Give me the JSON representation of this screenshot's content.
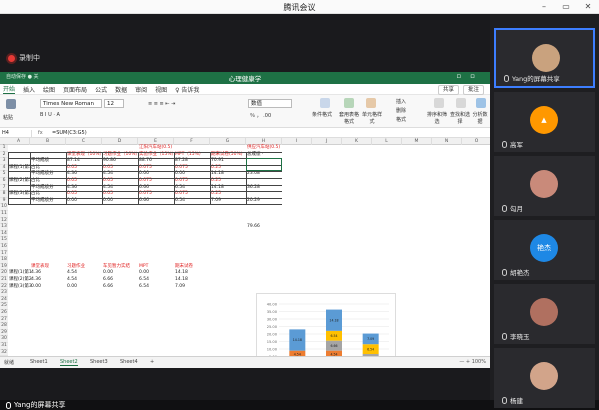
{
  "app": {
    "title": "腾讯会议",
    "window_controls": [
      "–",
      "▭",
      "✕"
    ]
  },
  "recording": {
    "label": "录制中"
  },
  "excel": {
    "autosave": "自动保存",
    "autosave_state": "● 关",
    "title": "心理健康学",
    "menus": [
      "开始",
      "插入",
      "绘图",
      "页面布局",
      "公式",
      "数据",
      "审阅",
      "视图",
      "♀ 告诉我"
    ],
    "share_labels": [
      "共享",
      "批注"
    ],
    "ribbon": {
      "paste": "粘贴",
      "font_name": "Times New Roman",
      "font_size": "12",
      "font_controls": "B  I  U  ·  A",
      "align_controls": "≡ ≡ ≡  ⇤ ⇥",
      "number_format": "数值",
      "number_controls": "％  ，  .00",
      "styles": [
        "条件格式",
        "套用表格格式",
        "单元格样式"
      ],
      "cells": [
        "插入",
        "删除",
        "格式"
      ],
      "edit": [
        "排序和筛选",
        "查找和选择",
        "分析数据"
      ]
    },
    "namebox": "H4",
    "fx": "fx",
    "formula": "=SUM(C3:G5)",
    "columns": [
      "A",
      "B",
      "C",
      "D",
      "E",
      "F",
      "G",
      "H",
      "I",
      "J",
      "K",
      "L",
      "M",
      "N",
      "O"
    ],
    "rows": [
      "1",
      "2",
      "3",
      "4",
      "5",
      "6",
      "7",
      "8",
      "9",
      "10",
      "11",
      "12",
      "13",
      "14",
      "15",
      "16",
      "17",
      "18",
      "19",
      "20",
      "21",
      "22",
      "23",
      "24",
      "25",
      "26",
      "27",
      "28",
      "29",
      "30",
      "31",
      "32"
    ],
    "table1": {
      "hdr_top_c": "江阳汽车站(0.5)",
      "hdr_top_g": "供应汽车站(0.5)",
      "headers": [
        "课堂表现（10%）",
        "习题作业（10%）",
        "实验作业（15%）",
        "MPT（15%）",
        "期末试卷(50%)",
        "总成绩 ·"
      ],
      "rows": [
        [
          "",
          "平均成绩",
          "87.14",
          "90.86",
          "88.76",
          "87.28",
          "70.91",
          ""
        ],
        [
          "课程(1)第1",
          "占比",
          "0.05",
          "0.05",
          "0.075",
          "0.075",
          "0.25",
          ""
        ],
        [
          "",
          "平均成绩分",
          "4.36",
          "4.54",
          "0.00",
          "0.00",
          "14.18",
          "23.08"
        ],
        [
          "课程(2)第1",
          "占比",
          "0.05",
          "0.05",
          "0.075",
          "0.075",
          "0.25",
          ""
        ],
        [
          "",
          "平均成绩分",
          "4.36",
          "4.54",
          "6.66",
          "6.54",
          "14.18",
          "36.28"
        ],
        [
          "课程(3)第1",
          "占比",
          "0.05",
          "0.05",
          "0.075",
          "0.075",
          "0.25",
          ""
        ],
        [
          "",
          "平均成绩分",
          "0.00",
          "0.00",
          "6.66",
          "6.54",
          "7.09",
          "20.29"
        ]
      ],
      "total": "79.66"
    },
    "table2": {
      "headers": [
        "课堂表现",
        "习题作业",
        "车见暂力实结",
        "MPT",
        "期末试卷"
      ],
      "rows": [
        [
          "课程(1)第1",
          "4.36",
          "4.54",
          "0.00",
          "0.00",
          "14.18"
        ],
        [
          "课程(2)第2",
          "4.36",
          "4.54",
          "6.66",
          "6.54",
          "14.18"
        ],
        [
          "课程(3)第3",
          "0.00",
          "0.00",
          "6.66",
          "6.54",
          "7.09"
        ]
      ]
    },
    "sheets": [
      "Sheet1",
      "Sheet2",
      "Sheet3",
      "Sheet4",
      "+"
    ],
    "active_sheet": "Sheet2",
    "status_left": "就绪",
    "status_right": "— + 100%"
  },
  "chart_data": {
    "type": "bar",
    "stacked": true,
    "categories": [
      "课程(1)第1",
      "课程(2)第2",
      "课程(3)第3"
    ],
    "series": [
      {
        "name": "课堂表现",
        "color": "#4472c4",
        "values": [
          4.36,
          4.36,
          0.0
        ]
      },
      {
        "name": "习题作业",
        "color": "#ed7d31",
        "values": [
          4.54,
          4.54,
          0.0
        ]
      },
      {
        "name": "车见暂力实结",
        "color": "#a5a5a5",
        "values": [
          0.0,
          6.66,
          6.66
        ]
      },
      {
        "name": "MPT",
        "color": "#ffc000",
        "values": [
          0.0,
          6.54,
          6.54
        ]
      },
      {
        "name": "期末试卷",
        "color": "#5b9bd5",
        "values": [
          14.18,
          14.18,
          7.09
        ]
      }
    ],
    "ylim": [
      0,
      40
    ],
    "yticks": [
      "40.00",
      "35.00",
      "30.00",
      "25.00",
      "20.00",
      "15.00",
      "10.00",
      "5.00",
      "0.00"
    ],
    "grid": true,
    "legend": "bottom"
  },
  "participants": [
    {
      "name": "Yang的屏幕共享",
      "selected": true,
      "avatar_color": "#c9a27e",
      "avatar_text": ""
    },
    {
      "name": "高军",
      "selected": false,
      "avatar_color": "#ff9800",
      "avatar_text": "▲"
    },
    {
      "name": "勾月",
      "selected": false,
      "avatar_color": "#c98a7a",
      "avatar_text": ""
    },
    {
      "name": "胡艳杰",
      "selected": false,
      "avatar_color": "#1e88e5",
      "avatar_text": "艳杰"
    },
    {
      "name": "李晓玉",
      "selected": false,
      "avatar_color": "#b07060",
      "avatar_text": ""
    },
    {
      "name": "杨建",
      "selected": false,
      "avatar_color": "#d2a48a",
      "avatar_text": ""
    }
  ],
  "presenter_label": "Yang的屏幕共享"
}
